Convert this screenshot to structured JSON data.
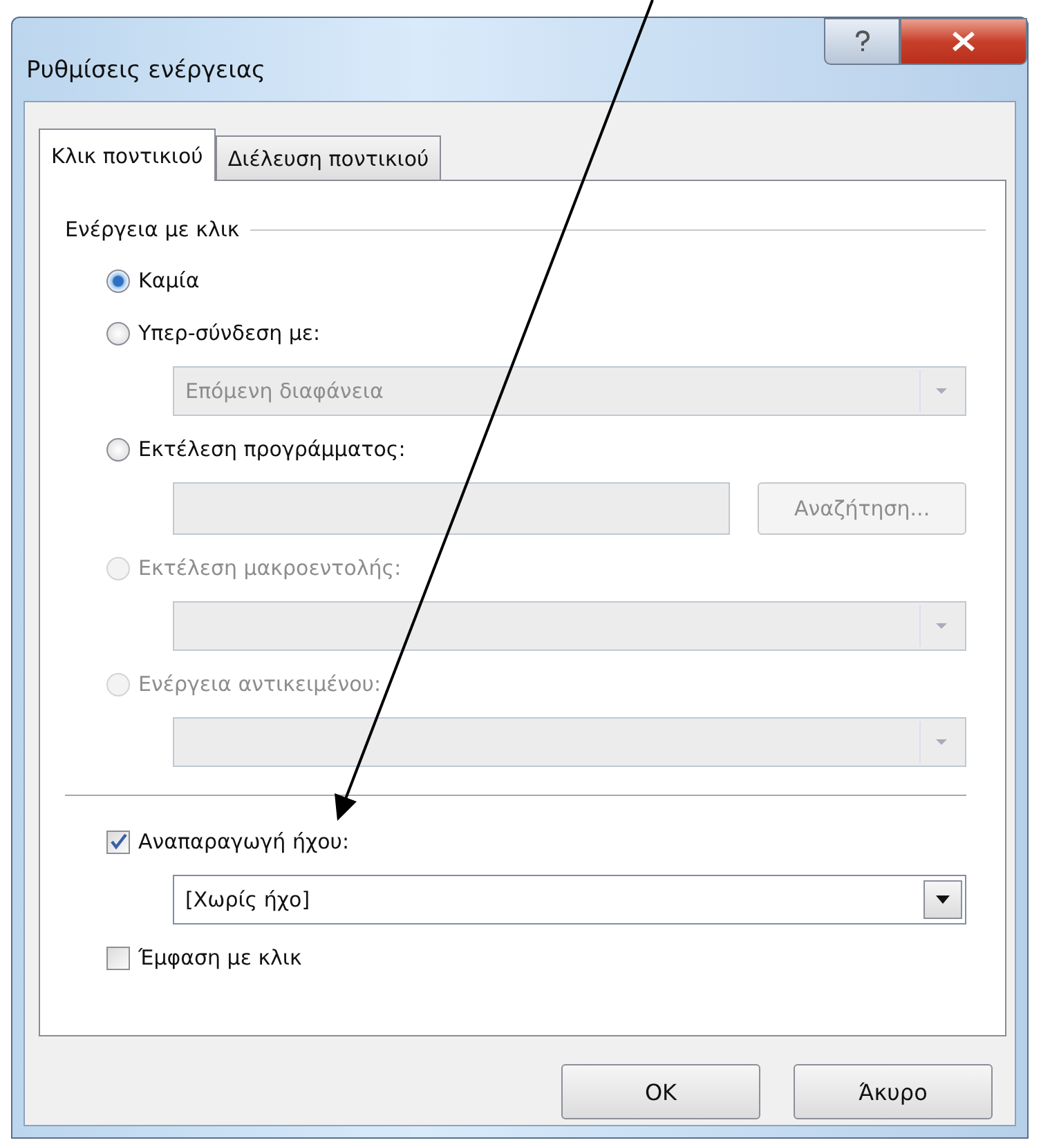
{
  "window": {
    "title": "Ρυθμίσεις ενέργειας"
  },
  "tabs": [
    {
      "label": "Κλικ ποντικιού",
      "selected": true
    },
    {
      "label": "Διέλευση ποντικιού",
      "selected": false
    }
  ],
  "group": {
    "title": "Ενέργεια με κλικ"
  },
  "options": [
    {
      "label": "Καμία",
      "selected": true,
      "disabled": false
    },
    {
      "label": "Υπερ-σύνδεση με:",
      "selected": false,
      "disabled": false,
      "control": {
        "kind": "dropdown",
        "value": "Επόμενη διαφάνεια",
        "disabled": true
      }
    },
    {
      "label": "Εκτέλεση προγράμματος:",
      "selected": false,
      "disabled": false,
      "control": {
        "kind": "field",
        "button": "Αναζήτηση...",
        "disabled": true
      }
    },
    {
      "label": "Εκτέλεση μακροεντολής:",
      "selected": false,
      "disabled": true,
      "control": {
        "kind": "dropdown",
        "disabled": true
      }
    },
    {
      "label": "Ενέργεια αντικειμένου:",
      "selected": false,
      "disabled": true,
      "control": {
        "kind": "dropdown",
        "disabled": true
      }
    }
  ],
  "sound": {
    "label": "Αναπαραγωγή ήχου:",
    "checked": true,
    "dropdown": {
      "value": "[Χωρίς ήχο]",
      "disabled": false
    }
  },
  "emphasis": {
    "label": "Έμφαση με κλικ",
    "checked": false
  },
  "buttons": [
    "OK",
    "Άκυρο"
  ]
}
